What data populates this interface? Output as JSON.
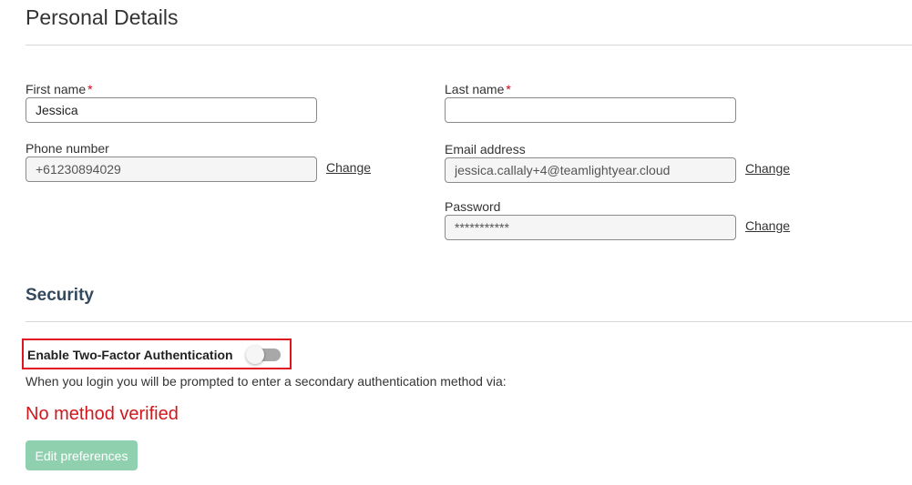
{
  "personal_details": {
    "title": "Personal Details",
    "required_marker": "*",
    "first_name": {
      "label": "First name",
      "value": "Jessica"
    },
    "last_name": {
      "label": "Last name",
      "value": ""
    },
    "phone": {
      "label": "Phone number",
      "value": "+61230894029",
      "change_label": "Change"
    },
    "email": {
      "label": "Email address",
      "value": "jessica.callaly+4@teamlightyear.cloud",
      "change_label": "Change"
    },
    "password": {
      "label": "Password",
      "value": "***********",
      "change_label": "Change"
    }
  },
  "security": {
    "title": "Security",
    "tfa_label": "Enable Two-Factor Authentication",
    "tfa_enabled": false,
    "tfa_description": "When you login you will be prompted to enter a secondary authentication method via:",
    "no_method_text": "No method verified",
    "edit_button_label": "Edit preferences"
  },
  "colors": {
    "required": "#d0021b",
    "highlight_border": "#e0141e",
    "error_text": "#d0171d",
    "button_disabled": "#8fd0ae",
    "security_title": "#34495e"
  },
  "icons": {
    "toggle": "toggle-off-icon"
  }
}
